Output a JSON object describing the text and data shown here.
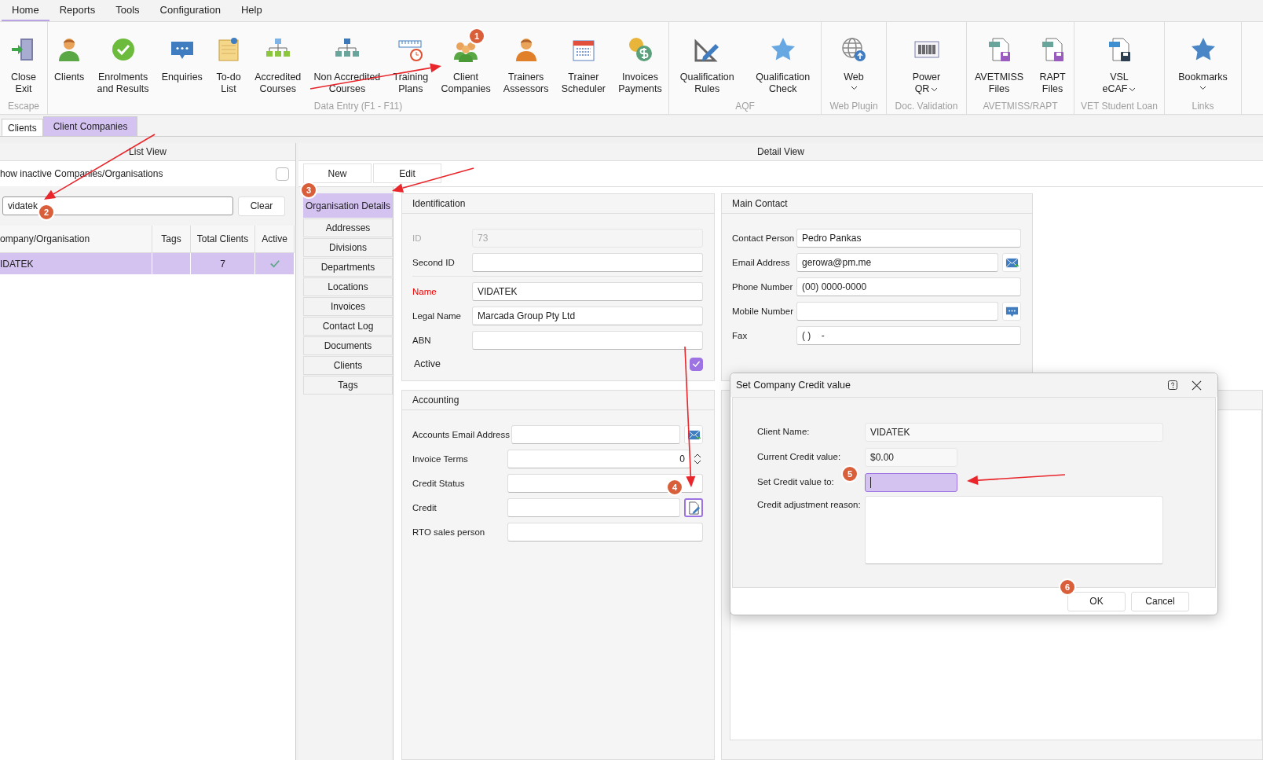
{
  "menu": [
    {
      "label": "Home",
      "selected": true
    },
    {
      "label": "Reports",
      "selected": false
    },
    {
      "label": "Tools",
      "selected": false
    },
    {
      "label": "Configuration",
      "selected": false
    },
    {
      "label": "Help",
      "selected": false
    }
  ],
  "ribbon": {
    "groups": [
      {
        "label": "Escape",
        "buttons": [
          {
            "label": "Close\nExit"
          }
        ]
      },
      {
        "label": "Data Entry (F1 - F11)",
        "buttons": [
          {
            "label": "Clients"
          },
          {
            "label": "Enrolments\nand Results"
          },
          {
            "label": "Enquiries"
          },
          {
            "label": "To-do\nList"
          },
          {
            "label": "Accredited\nCourses"
          },
          {
            "label": "Non Accredited\nCourses"
          },
          {
            "label": "Training\nPlans"
          },
          {
            "label": "Client\nCompanies"
          },
          {
            "label": "Trainers\nAssessors"
          },
          {
            "label": "Trainer\nScheduler"
          },
          {
            "label": "Invoices\nPayments"
          }
        ]
      },
      {
        "label": "AQF",
        "buttons": [
          {
            "label": "Qualification\nRules"
          },
          {
            "label": "Qualification\nCheck"
          }
        ]
      },
      {
        "label": "Web Plugin",
        "buttons": [
          {
            "label": "Web",
            "dropdown": true
          }
        ]
      },
      {
        "label": "Doc. Validation",
        "buttons": [
          {
            "label": "Power\nQR",
            "dropdown": true
          }
        ]
      },
      {
        "label": "AVETMISS/RAPT",
        "buttons": [
          {
            "label": "AVETMISS\nFiles"
          },
          {
            "label": "RAPT\nFiles"
          }
        ]
      },
      {
        "label": "VET Student Loan",
        "buttons": [
          {
            "label": "VSL\neCAF",
            "dropdown": true
          }
        ]
      },
      {
        "label": "Links",
        "buttons": [
          {
            "label": "Bookmarks",
            "dropdown": true
          }
        ]
      }
    ]
  },
  "doc_tabs": [
    {
      "label": "Clients",
      "selected": false
    },
    {
      "label": "Client Companies",
      "selected": true
    }
  ],
  "list_view": {
    "title": "List View",
    "show_inactive": {
      "label": "how inactive Companies/Organisations",
      "checked": false
    },
    "search": {
      "value": "vidatek"
    },
    "clear_button": "Clear",
    "table": {
      "columns": [
        "ompany/Organisation",
        "Tags",
        "Total Clients",
        "Active"
      ],
      "rows": [
        {
          "company": "IDATEK",
          "total_clients": "7",
          "active": true,
          "selected": true
        }
      ]
    }
  },
  "detail_view": {
    "title": "Detail View",
    "toolbar": [
      "New",
      "Edit"
    ],
    "sections": [
      {
        "label": "Organisation Details",
        "selected": true
      },
      {
        "label": "Addresses",
        "selected": false
      },
      {
        "label": "Divisions",
        "selected": false
      },
      {
        "label": "Departments",
        "selected": false
      },
      {
        "label": "Locations",
        "selected": false
      },
      {
        "label": "Invoices",
        "selected": false
      },
      {
        "label": "Contact Log",
        "selected": false
      },
      {
        "label": "Documents",
        "selected": false
      },
      {
        "label": "Clients",
        "selected": false
      },
      {
        "label": "Tags",
        "selected": false
      }
    ],
    "panels": [
      {
        "kind": "form",
        "title": "Identification",
        "fields": [
          {
            "kind": "text",
            "label": "ID",
            "value": "73",
            "disabled": true,
            "required": false
          },
          {
            "kind": "text",
            "label": "Second ID",
            "disabled": false,
            "required": false
          },
          {
            "kind": "separator"
          },
          {
            "kind": "text",
            "label": "Name",
            "value": "VIDATEK",
            "disabled": false,
            "required": true
          },
          {
            "kind": "text",
            "label": "Legal Name",
            "value": "Marcada Group Pty Ltd",
            "disabled": false,
            "required": false
          },
          {
            "kind": "text",
            "label": "ABN",
            "disabled": false,
            "required": false
          },
          {
            "kind": "checkbox",
            "label": "Active",
            "checked": true
          }
        ]
      },
      {
        "kind": "form",
        "title": "Main Contact",
        "fields": [
          {
            "kind": "text",
            "label": "Contact Person",
            "value": "Pedro Pankas",
            "disabled": false,
            "required": false
          },
          {
            "kind": "text",
            "label": "Email Address",
            "value": "gerowa@pm.me",
            "addon": {
              "kind": "email"
            },
            "disabled": false,
            "required": false
          },
          {
            "kind": "text",
            "label": "Phone Number",
            "value": "(00) 0000-0000",
            "disabled": false,
            "required": false
          },
          {
            "kind": "text",
            "label": "Mobile Number",
            "addon": {
              "kind": "sms"
            },
            "disabled": false,
            "required": false
          },
          {
            "kind": "text",
            "label": "Fax",
            "value": "( )    -",
            "disabled": false,
            "required": false
          }
        ]
      },
      {
        "kind": "form",
        "title": "Accounting",
        "fields": [
          {
            "kind": "text",
            "label": "Accounts Email Address",
            "addon": {
              "kind": "email"
            },
            "disabled": false,
            "required": false
          },
          {
            "kind": "number",
            "label": "Invoice Terms",
            "value": "0",
            "disabled": false,
            "required": false
          },
          {
            "kind": "text",
            "label": "Credit Status",
            "disabled": false,
            "required": false
          },
          {
            "kind": "text",
            "label": "Credit",
            "addon": {
              "kind": "edit"
            },
            "disabled": false,
            "required": false
          },
          {
            "kind": "text",
            "label": "RTO sales person",
            "disabled": false,
            "required": false
          }
        ]
      },
      {
        "kind": "blank"
      }
    ]
  },
  "dialog": {
    "title": "Set Company Credit value",
    "fields": [
      {
        "kind": "text",
        "label": "Client Name:",
        "value": "VIDATEK",
        "readonly": true,
        "focused": false
      },
      {
        "kind": "text",
        "label": "Current Credit value:",
        "value": "$0.00",
        "readonly": true,
        "focused": false
      },
      {
        "kind": "text",
        "label": "Set Credit value to:",
        "readonly": false,
        "focused": true
      },
      {
        "kind": "textarea",
        "label": "Credit adjustment reason:",
        "readonly": false,
        "focused": false
      }
    ],
    "buttons": [
      "OK",
      "Cancel"
    ]
  },
  "annotations": {
    "badges": [
      "1",
      "2",
      "3",
      "4",
      "5",
      "6"
    ]
  }
}
